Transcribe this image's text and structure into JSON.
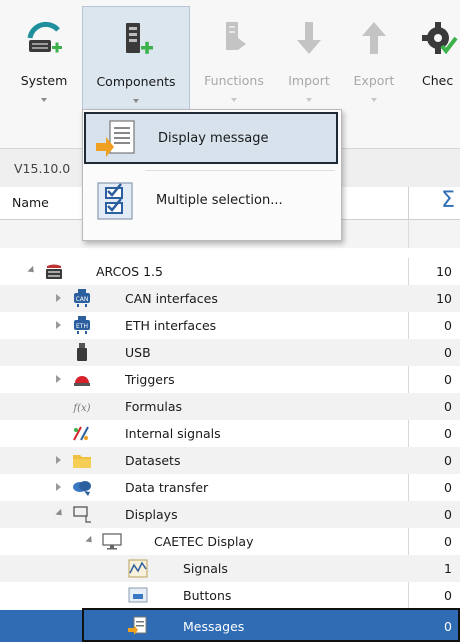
{
  "ribbon": {
    "buttons": [
      {
        "label": "System",
        "icon": "system-hardware-add-icon",
        "enabled": true
      },
      {
        "label": "Components",
        "icon": "component-add-icon",
        "enabled": true,
        "active": true
      },
      {
        "label": "Functions",
        "icon": "function-arrow-icon",
        "enabled": false
      },
      {
        "label": "Import",
        "icon": "import-arrow-down-icon",
        "enabled": false
      },
      {
        "label": "Export",
        "icon": "export-arrow-up-icon",
        "enabled": false
      },
      {
        "label": "Chec",
        "icon": "check-gear-icon",
        "enabled": true
      }
    ]
  },
  "version": "V15.10.0",
  "grid": {
    "col_name": "Name",
    "col_sum": "Σ"
  },
  "dropdown": {
    "items": [
      {
        "label": "Display message",
        "icon": "display-message-icon",
        "highlighted": true
      },
      {
        "label": "Multiple selection...",
        "icon": "multiple-selection-icon",
        "highlighted": false
      }
    ]
  },
  "tree": [
    {
      "label": "ARCOS 1.5",
      "value": "10",
      "icon": "device-icon",
      "expander": "open"
    },
    {
      "label": "CAN interfaces",
      "value": "10",
      "icon": "can-interface-icon",
      "expander": "closed"
    },
    {
      "label": "ETH interfaces",
      "value": "0",
      "icon": "eth-interface-icon",
      "expander": "closed"
    },
    {
      "label": "USB",
      "value": "0",
      "icon": "usb-icon",
      "expander": "none"
    },
    {
      "label": "Triggers",
      "value": "0",
      "icon": "trigger-icon",
      "expander": "closed"
    },
    {
      "label": "Formulas",
      "value": "0",
      "icon": "formula-icon",
      "expander": "none"
    },
    {
      "label": "Internal signals",
      "value": "0",
      "icon": "internal-signals-icon",
      "expander": "none"
    },
    {
      "label": "Datasets",
      "value": "0",
      "icon": "folder-icon",
      "expander": "closed"
    },
    {
      "label": "Data transfer",
      "value": "0",
      "icon": "data-transfer-icon",
      "expander": "closed"
    },
    {
      "label": "Displays",
      "value": "0",
      "icon": "displays-icon",
      "expander": "open"
    },
    {
      "label": "CAETEC Display",
      "value": "0",
      "icon": "monitor-icon",
      "expander": "open"
    },
    {
      "label": "Signals",
      "value": "1",
      "icon": "signals-chart-icon",
      "expander": "none"
    },
    {
      "label": "Buttons",
      "value": "0",
      "icon": "buttons-icon",
      "expander": "none"
    },
    {
      "label": "Messages",
      "value": "0",
      "icon": "messages-icon",
      "expander": "none",
      "selected": true
    }
  ],
  "colors": {
    "selection": "#2f6cb3",
    "accent_green": "#3bb24a",
    "teal": "#1f8f9e",
    "sum_blue": "#2f6fb5"
  }
}
